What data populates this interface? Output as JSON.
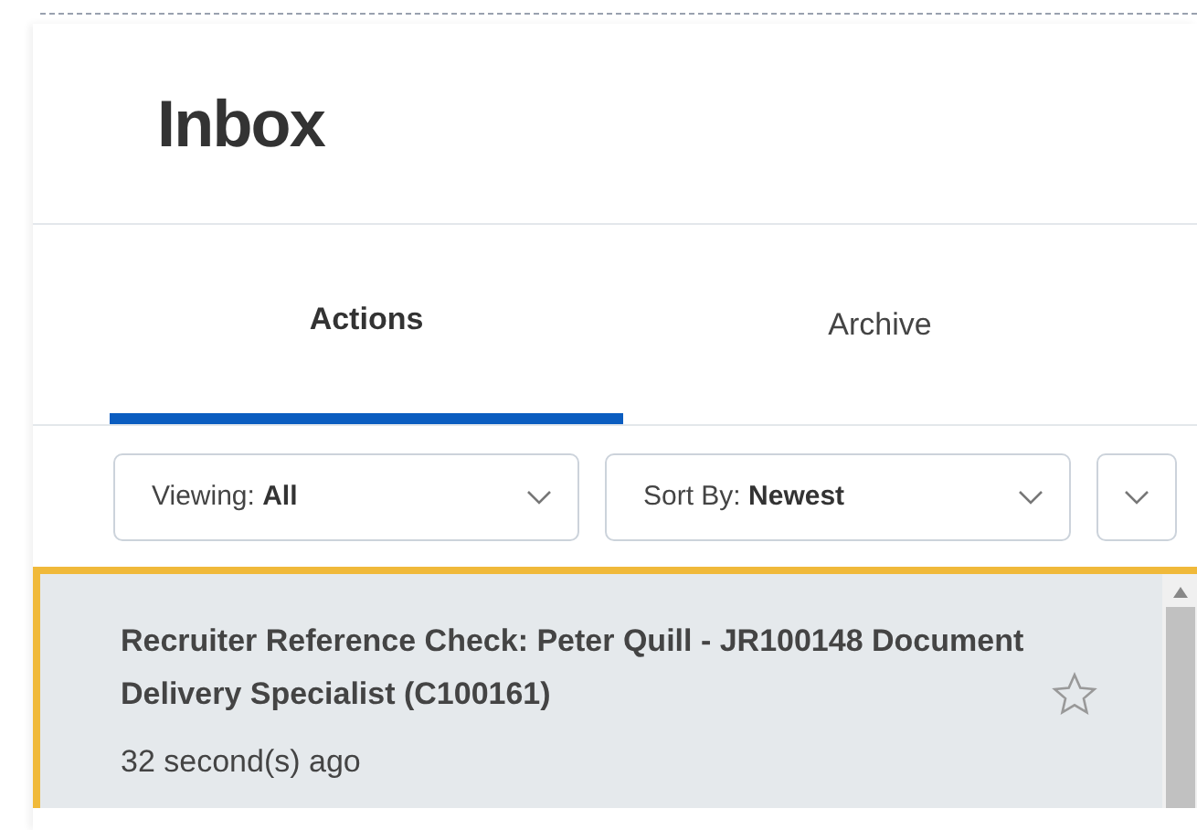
{
  "header": {
    "title": "Inbox"
  },
  "tabs": [
    {
      "label": "Actions",
      "selected": true
    },
    {
      "label": "Archive",
      "selected": false
    }
  ],
  "filters": [
    {
      "label": "Viewing:",
      "value": "All"
    },
    {
      "label": "Sort By:",
      "value": "Newest"
    }
  ],
  "items": [
    {
      "title": "Recruiter Reference Check: Peter Quill - JR100148 Document Delivery Specialist (C100161)",
      "time": "32 second(s) ago",
      "selected": true,
      "starred": false
    }
  ]
}
